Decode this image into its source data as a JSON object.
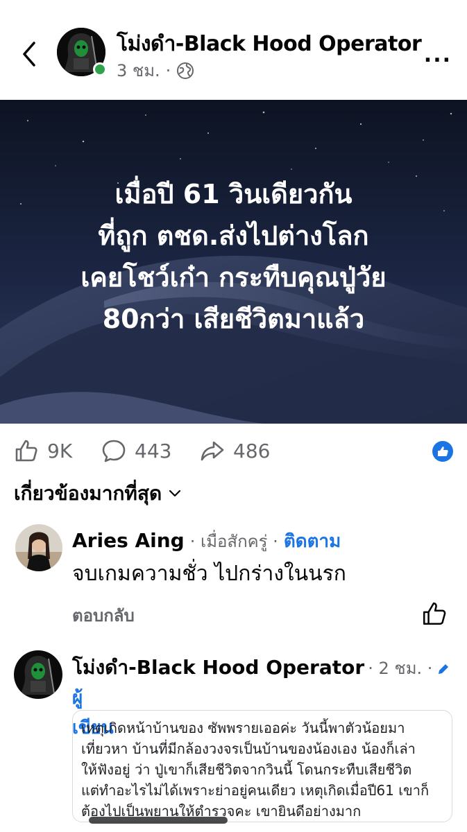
{
  "header": {
    "page_name": "โม่งดำ-Black Hood Operator",
    "time": "3 ชม.",
    "separator": "·",
    "audience_icon": "globe-icon",
    "more_label": "..."
  },
  "post": {
    "image_lines": [
      "เมื่อปี 61 วินเดียวกัน",
      "ที่ถูก ตชด.ส่งไปต่างโลก",
      "เคยโชว์เก๋า กระทืบคุณปู่วัย",
      "80กว่า เสียชีวิตมาแล้ว"
    ]
  },
  "reactions": {
    "likes": "9K",
    "comments": "443",
    "shares": "486"
  },
  "sort": {
    "label": "เกี่ยวข้องมากที่สุด"
  },
  "comments": [
    {
      "name": "Aries Aing",
      "meta": "· เมื่อสักครู่ ·",
      "follow": "ติดตาม",
      "text": "จบเกมความชั่ว ไปกร่างในนรก",
      "reply_label": "ตอบกลับ"
    },
    {
      "name": "โม่งดำ-Black Hood Operator",
      "meta": "· 2 ชม. ·",
      "author_label_a": "ผู้",
      "author_label_b": "เขียน",
      "quote_lines": [
        "เหตุเกิดหน้าบ้านของ ซัพพรายเออค่ะ วันนี้พาตัวน้อยมา",
        "เที่ยวหา บ้านที่มีกล้องวงจรเป็นบ้านของน้องเอง น้องก็เล่า",
        "ให้ฟังอยู่ ว่า ปู่เขาก็เสียชีวิตจากวินนี้ โดนกระทืบเสียชีวิต",
        "แต่ทำอะไรไม่ได้เพราะย่าอยู่คนเดียว เหตุเกิดเมื่อปี61 เขาก็",
        "ต้องไปเป็นพยานให้ตำรวจคะ เขายินดีอย่างมาก"
      ]
    }
  ],
  "colors": {
    "accent": "#1b74e4",
    "online": "#31a24c",
    "muted_text": "#65676b"
  }
}
